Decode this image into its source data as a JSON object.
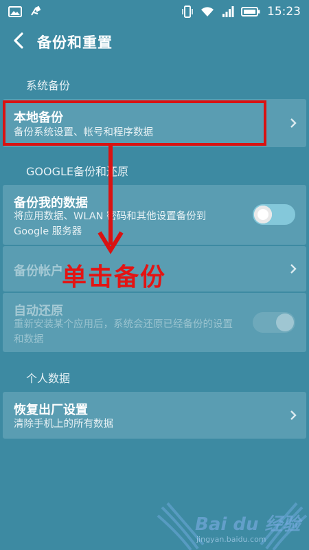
{
  "status_bar": {
    "time": "15:23",
    "left_icons": [
      "image-icon",
      "usb-icon"
    ],
    "right_icons": [
      "vibrate-icon",
      "wifi-icon",
      "signal-icon",
      "battery-icon"
    ]
  },
  "app_bar": {
    "back_icon": "chevron-left-icon",
    "title": "备份和重置"
  },
  "sections": {
    "system_backup": "系统备份",
    "google": "GOOGLE备份和还原",
    "personal": "个人数据"
  },
  "items": {
    "local_backup": {
      "title": "本地备份",
      "subtitle": "备份系统设置、帐号和程序数据"
    },
    "backup_my_data": {
      "title": "备份我的数据",
      "subtitle": "将应用数据、WLAN 密码和其他设置备份到 Google 服务器",
      "toggle_on": true
    },
    "backup_account": {
      "title": "备份帐户"
    },
    "auto_restore": {
      "title": "自动还原",
      "subtitle": "重新安装某个应用后，系统会还原已经备份的设置和数据",
      "toggle_on": false
    },
    "factory_reset": {
      "title": "恢复出厂设置",
      "subtitle": "清除手机上的所有数据"
    }
  },
  "annotation": {
    "text": "单击备份",
    "color": "#e31414"
  },
  "watermark": {
    "brand": "Bai du 经验",
    "url": "jingyan.baidu.com"
  },
  "colors": {
    "background": "#3d8aa2",
    "card": "#5a9db2",
    "toggle_on": "#84c8da",
    "highlight": "#d91212"
  }
}
